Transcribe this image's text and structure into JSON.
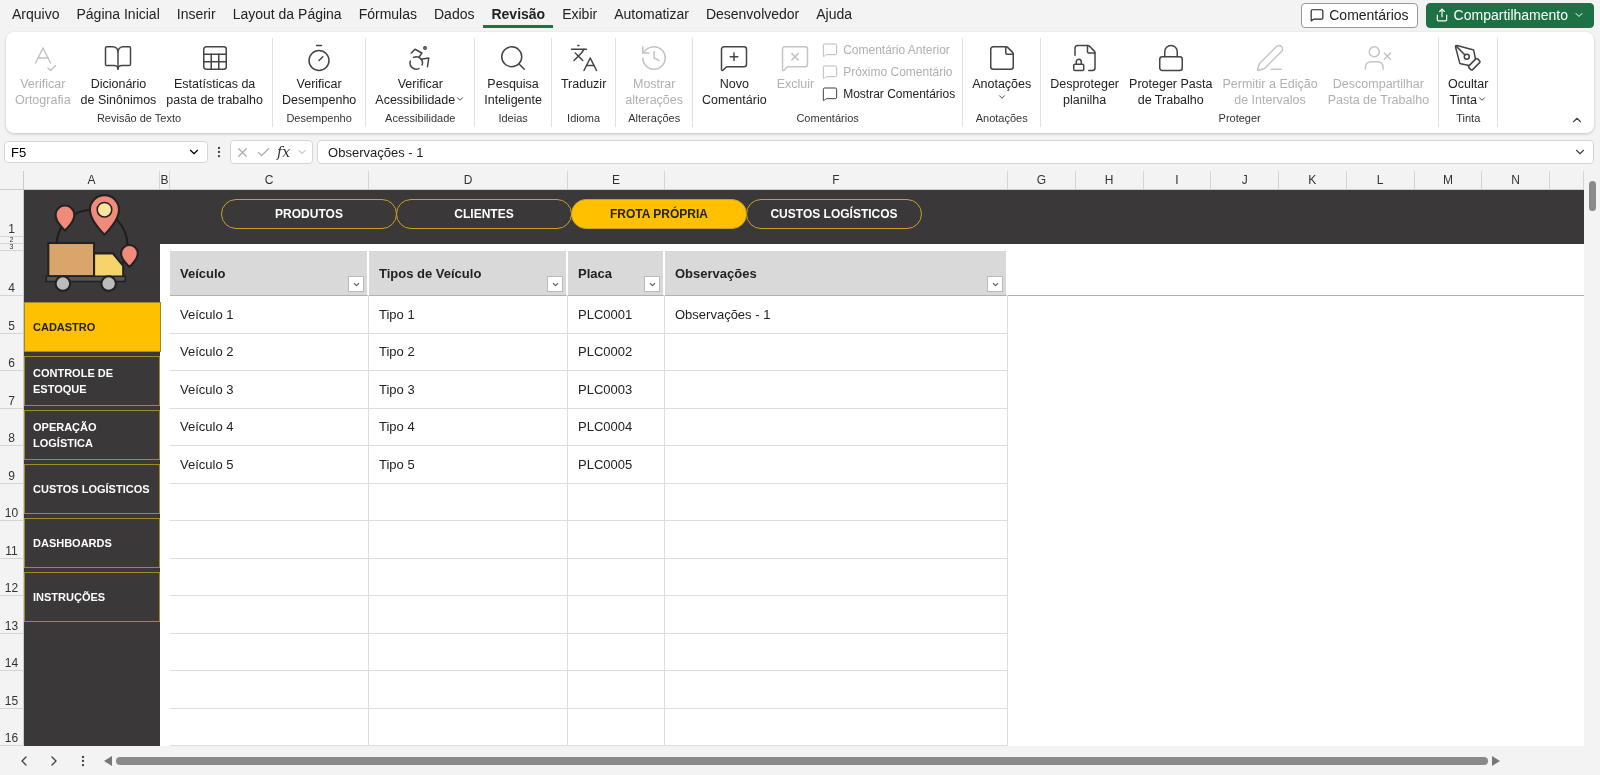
{
  "menu": {
    "tabs": [
      {
        "label": "Arquivo",
        "selected": false
      },
      {
        "label": "Página Inicial",
        "selected": false
      },
      {
        "label": "Inserir",
        "selected": false
      },
      {
        "label": "Layout da Página",
        "selected": false
      },
      {
        "label": "Fórmulas",
        "selected": false
      },
      {
        "label": "Dados",
        "selected": false
      },
      {
        "label": "Revisão",
        "selected": true
      },
      {
        "label": "Exibir",
        "selected": false
      },
      {
        "label": "Automatizar",
        "selected": false
      },
      {
        "label": "Desenvolvedor",
        "selected": false
      },
      {
        "label": "Ajuda",
        "selected": false
      }
    ],
    "buttons": [
      {
        "label": "Comentários",
        "kind": "outline"
      },
      {
        "label": "Compartilhamento",
        "kind": "primary"
      }
    ]
  },
  "ribbon": {
    "groups": [
      {
        "label": "Revisão de Texto",
        "items": [
          {
            "kind": "large",
            "lines": [
              "Verificar",
              "Ortografia"
            ],
            "disabled": true,
            "dropdown": false
          },
          {
            "kind": "large",
            "lines": [
              "Dicionário",
              "de Sinônimos"
            ],
            "disabled": false,
            "dropdown": false
          },
          {
            "kind": "large",
            "lines": [
              "Estatísticas da",
              "pasta de trabalho"
            ],
            "disabled": false,
            "dropdown": false
          }
        ]
      },
      {
        "label": "Desempenho",
        "items": [
          {
            "kind": "large",
            "lines": [
              "Verificar",
              "Desempenho"
            ],
            "disabled": false,
            "dropdown": false
          }
        ]
      },
      {
        "label": "Acessibilidade",
        "items": [
          {
            "kind": "large",
            "lines": [
              "Verificar",
              "Acessibilidade"
            ],
            "disabled": false,
            "dropdown": true
          }
        ]
      },
      {
        "label": "Ideias",
        "items": [
          {
            "kind": "large",
            "lines": [
              "Pesquisa",
              "Inteligente"
            ],
            "disabled": false,
            "dropdown": false
          }
        ]
      },
      {
        "label": "Idioma",
        "items": [
          {
            "kind": "large",
            "lines": [
              "Traduzir"
            ],
            "disabled": false,
            "dropdown": false
          }
        ]
      },
      {
        "label": "Alterações",
        "items": [
          {
            "kind": "large",
            "lines": [
              "Mostrar",
              "alterações"
            ],
            "disabled": true,
            "dropdown": false
          }
        ]
      },
      {
        "label": "Comentários",
        "items": [
          {
            "kind": "large",
            "lines": [
              "Novo",
              "Comentário"
            ],
            "disabled": false,
            "dropdown": false
          },
          {
            "kind": "large",
            "lines": [
              "Excluir"
            ],
            "disabled": true,
            "dropdown": false
          },
          {
            "kind": "small",
            "lines": [
              "Comentário Anterior"
            ],
            "disabled": true
          },
          {
            "kind": "small",
            "lines": [
              "Próximo Comentário"
            ],
            "disabled": true
          },
          {
            "kind": "small",
            "lines": [
              "Mostrar Comentários"
            ],
            "disabled": false
          }
        ]
      },
      {
        "label": "Anotações",
        "items": [
          {
            "kind": "large",
            "lines": [
              "Anotações"
            ],
            "disabled": false,
            "dropdown": true
          }
        ]
      },
      {
        "label": "Proteger",
        "items": [
          {
            "kind": "large",
            "lines": [
              "Desproteger",
              "planilha"
            ],
            "disabled": false,
            "dropdown": false
          },
          {
            "kind": "large",
            "lines": [
              "Proteger Pasta",
              "de Trabalho"
            ],
            "disabled": false,
            "dropdown": false
          },
          {
            "kind": "large",
            "lines": [
              "Permitir a Edição",
              "de Intervalos"
            ],
            "disabled": true,
            "dropdown": false
          },
          {
            "kind": "large",
            "lines": [
              "Descompartilhar",
              "Pasta de Trabalho"
            ],
            "disabled": true,
            "dropdown": false
          }
        ]
      },
      {
        "label": "Tinta",
        "items": [
          {
            "kind": "large",
            "lines": [
              "Ocultar",
              "Tinta"
            ],
            "disabled": false,
            "dropdown": true
          }
        ]
      }
    ]
  },
  "formula_bar": {
    "name_box": "F5",
    "fx": "fx",
    "value": "Observações - 1"
  },
  "sheet": {
    "columns": [
      "A",
      "B",
      "C",
      "D",
      "E",
      "F",
      "G",
      "H",
      "I",
      "J",
      "K",
      "L",
      "M",
      "N"
    ],
    "rows": [
      "1",
      "2",
      "3",
      "4",
      "5",
      "6",
      "7",
      "8",
      "9",
      "10",
      "11",
      "12",
      "13",
      "14",
      "15",
      "16"
    ],
    "tabs": [
      {
        "label": "PRODUTOS",
        "selected": false
      },
      {
        "label": "CLIENTES",
        "selected": false
      },
      {
        "label": "FROTA PRÓPRIA",
        "selected": true
      },
      {
        "label": "CUSTOS LOGÍSTICOS",
        "selected": false
      }
    ],
    "nav": [
      {
        "label": "CADASTRO",
        "selected": true
      },
      {
        "label": "CONTROLE DE ESTOQUE",
        "selected": false
      },
      {
        "label": "OPERAÇÃO LOGÍSTICA",
        "selected": false
      },
      {
        "label": "CUSTOS LOGÍSTICOS",
        "selected": false
      },
      {
        "label": "DASHBOARDS",
        "selected": false
      },
      {
        "label": "INSTRUÇÕES",
        "selected": false
      }
    ],
    "table": {
      "columns": [
        "Veículo",
        "Tipos de Veículo",
        "Placa",
        "Observações"
      ],
      "rows": [
        {
          "cells": [
            "Veículo 1",
            "Tipo 1",
            "PLC0001",
            "Observações - 1"
          ]
        },
        {
          "cells": [
            "Veículo 2",
            "Tipo 2",
            "PLC0002"
          ]
        },
        {
          "cells": [
            "Veículo 3",
            "Tipo 3",
            "PLC0003"
          ]
        },
        {
          "cells": [
            "Veículo 4",
            "Tipo 4",
            "PLC0004"
          ]
        },
        {
          "cells": [
            "Veículo 5",
            "Tipo 5",
            "PLC0005"
          ]
        }
      ]
    }
  }
}
